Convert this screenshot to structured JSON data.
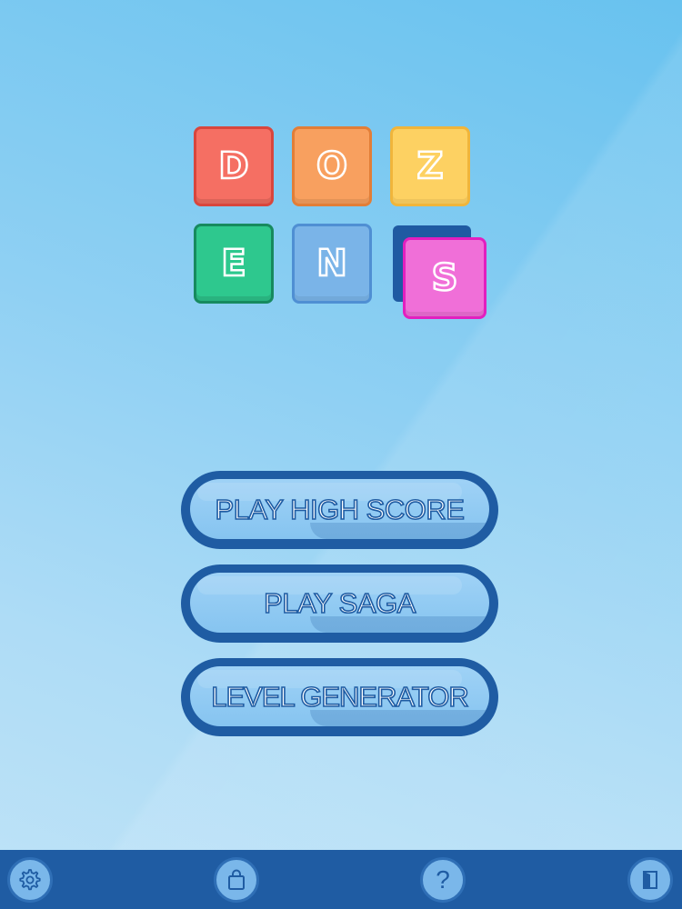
{
  "logo": {
    "letters": [
      "D",
      "O",
      "Z",
      "E",
      "N",
      "S"
    ],
    "colors": {
      "D": "#f56f63",
      "O": "#f8a05f",
      "Z": "#fdd162",
      "E": "#2ec88e",
      "N": "#7ab4e8",
      "S": "#f06fd8"
    }
  },
  "menu": {
    "play_high_score": "PLAY HIGH SCORE",
    "play_saga": "PLAY SAGA",
    "level_generator": "LEVEL GENERATOR"
  },
  "toolbar": {
    "icons": [
      "gear-icon",
      "shopping-bag-icon",
      "question-mark-icon",
      "exit-door-icon"
    ],
    "help_glyph": "?"
  },
  "colors": {
    "primary_dark": "#1f5ca3",
    "button_fill": "#86c4f0",
    "background": "#8fd0f3"
  }
}
